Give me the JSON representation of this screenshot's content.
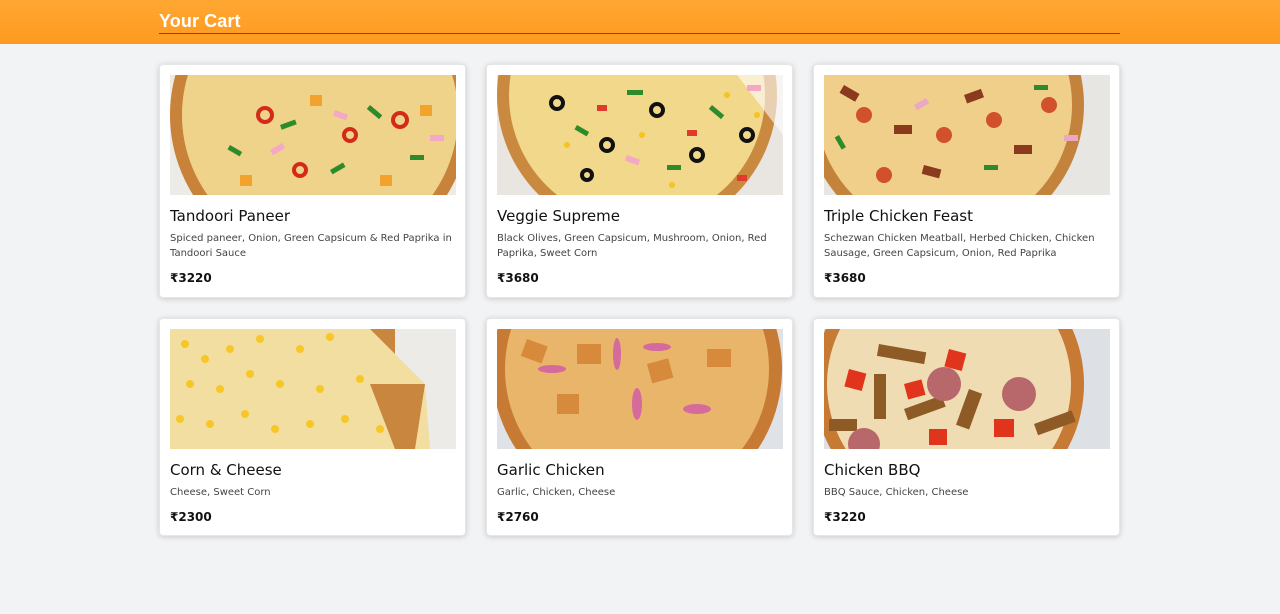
{
  "header": {
    "title": "Your Cart"
  },
  "colors": {
    "header": "#ff9f26",
    "background": "#f2f3f5",
    "card": "#ffffff"
  },
  "items": [
    {
      "name": "Tandoori Paneer",
      "description": "Spiced paneer, Onion, Green Capsicum & Red Paprika in Tandoori Sauce",
      "price": "₹3220",
      "image": "pizza-tandoori-paneer"
    },
    {
      "name": "Veggie Supreme",
      "description": "Black Olives, Green Capsicum, Mushroom, Onion, Red Paprika, Sweet Corn",
      "price": "₹3680",
      "image": "pizza-veggie-supreme"
    },
    {
      "name": "Triple Chicken Feast",
      "description": "Schezwan Chicken Meatball, Herbed Chicken, Chicken Sausage, Green Capsicum, Onion, Red Paprika",
      "price": "₹3680",
      "image": "pizza-triple-chicken"
    },
    {
      "name": "Corn & Cheese",
      "description": "Cheese, Sweet Corn",
      "price": "₹2300",
      "image": "pizza-corn-cheese"
    },
    {
      "name": "Garlic Chicken",
      "description": "Garlic, Chicken, Cheese",
      "price": "₹2760",
      "image": "pizza-garlic-chicken"
    },
    {
      "name": "Chicken BBQ",
      "description": "BBQ Sauce, Chicken, Cheese",
      "price": "₹3220",
      "image": "pizza-chicken-bbq"
    }
  ]
}
